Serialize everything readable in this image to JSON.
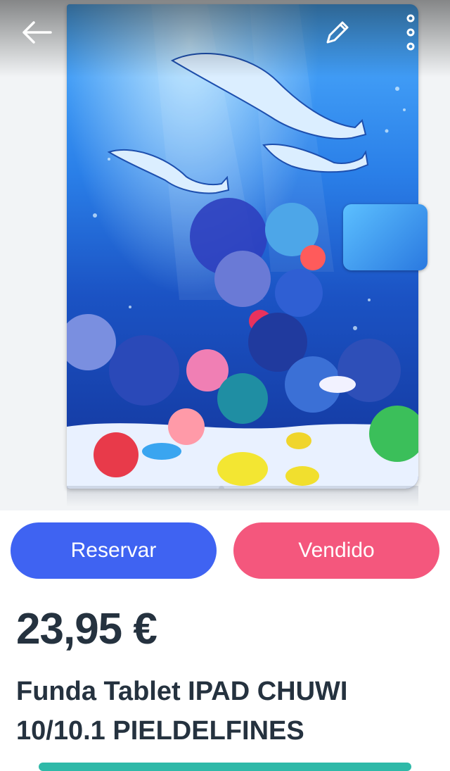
{
  "header": {
    "back_icon": "arrow-left-icon",
    "edit_icon": "pencil-icon",
    "more_icon": "more-vertical-icon"
  },
  "gallery": {
    "image_description_icon": "product-photo",
    "dots_total": 3,
    "active_dot": 1
  },
  "actions": {
    "reserve_label": "Reservar",
    "reserve_color": "#3f63f2",
    "sold_label": "Vendido",
    "sold_color": "#f4577d"
  },
  "product": {
    "price": "23,95 €",
    "title": "Funda Tablet IPAD CHUWI 10/10.1 PIELDELFINES"
  },
  "colors": {
    "text": "#25323f",
    "footer_accent": "#2fb9a8"
  }
}
